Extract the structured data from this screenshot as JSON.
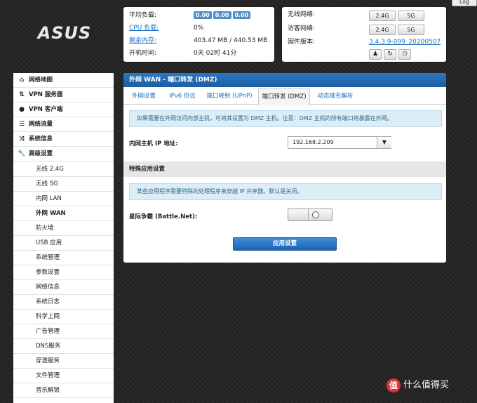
{
  "logo": {
    "text": "ASUS"
  },
  "logout": "Log",
  "system": {
    "load_label": "平均负载:",
    "load_values": [
      "0.00",
      "0.00",
      "0.00"
    ],
    "cpu_label": "CPU 负载:",
    "cpu_value": "0%",
    "mem_label": "剩余内存:",
    "mem_value": "403.47 MB / 440.53 MB",
    "uptime_label": "开机时间:",
    "uptime_value": "0天 02时 41分"
  },
  "network": {
    "wireless_label": "无线网络:",
    "guest_label": "访客网络:",
    "band_24": "2.4G",
    "band_5": "5G",
    "firmware_label": "固件版本:",
    "firmware_value": "3.4.3.9-099_20200507",
    "icons": [
      "user-icon",
      "refresh-icon",
      "power-icon"
    ]
  },
  "sidebar": {
    "top": [
      {
        "icon": "home-icon",
        "label": "网络地图"
      },
      {
        "icon": "vpn-server-icon",
        "label": "VPN 服务器"
      },
      {
        "icon": "globe-icon",
        "label": "VPN 客户端"
      },
      {
        "icon": "list-icon",
        "label": "网络流量"
      },
      {
        "icon": "shuffle-icon",
        "label": "系统信息"
      },
      {
        "icon": "wrench-icon",
        "label": "高级设置"
      }
    ],
    "sub": [
      "无线 2.4G",
      "无线 5G",
      "内网 LAN",
      "外网 WAN",
      "防火墙",
      "USB 应用",
      "系统管理",
      "参数设置",
      "网络信息",
      "系统日志",
      "科学上网",
      "广告管理",
      "DNS服务",
      "穿透服务",
      "文件管理",
      "音乐解锁"
    ],
    "active_sub": "外网 WAN"
  },
  "main": {
    "title": "外网 WAN - 端口转发 (DMZ)",
    "tabs": [
      "外网设置",
      "IPv6 协议",
      "端口映射 (UPnP)",
      "端口转发 (DMZ)",
      "动态域名解析"
    ],
    "active_tab": "端口转发 (DMZ)",
    "dmz_info": "如果需要在外网访问内部主机，可将其设置为 DMZ 主机。注意：DMZ 主机的所有端口将暴露在外网。",
    "ip_label": "内网主机 IP 地址:",
    "ip_value": "192.168.2.209",
    "section_title": "特殊应用设置",
    "special_info": "某些应用程序需要特殊的处理程序来穿越 IP 共享器。默认是关闭。",
    "starcraft_label": "星际争霸 (Battle.Net):",
    "apply_label": "应用设置"
  },
  "watermark": {
    "text": "什么值得买",
    "badge": "值"
  }
}
